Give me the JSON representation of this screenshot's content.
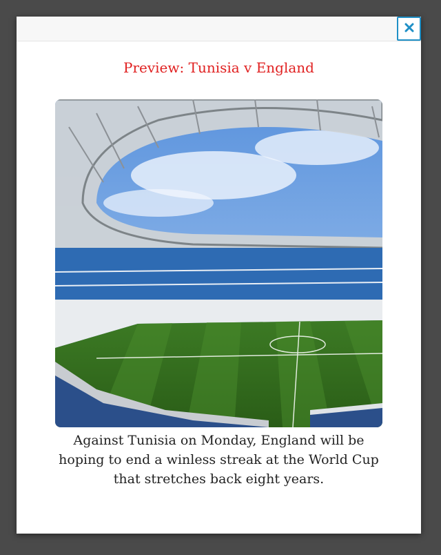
{
  "modal": {
    "title": "Preview: Tunisia v England",
    "close_icon": "close-icon",
    "image_alt": "stadium-photo",
    "caption": "Against Tunisia on Monday, England will be hoping to end a winless streak at the World Cup that stretches back eight years."
  },
  "colors": {
    "title": "#e01f1f",
    "close_border": "#1e8fc6",
    "overlay": "#4a4a4a"
  }
}
